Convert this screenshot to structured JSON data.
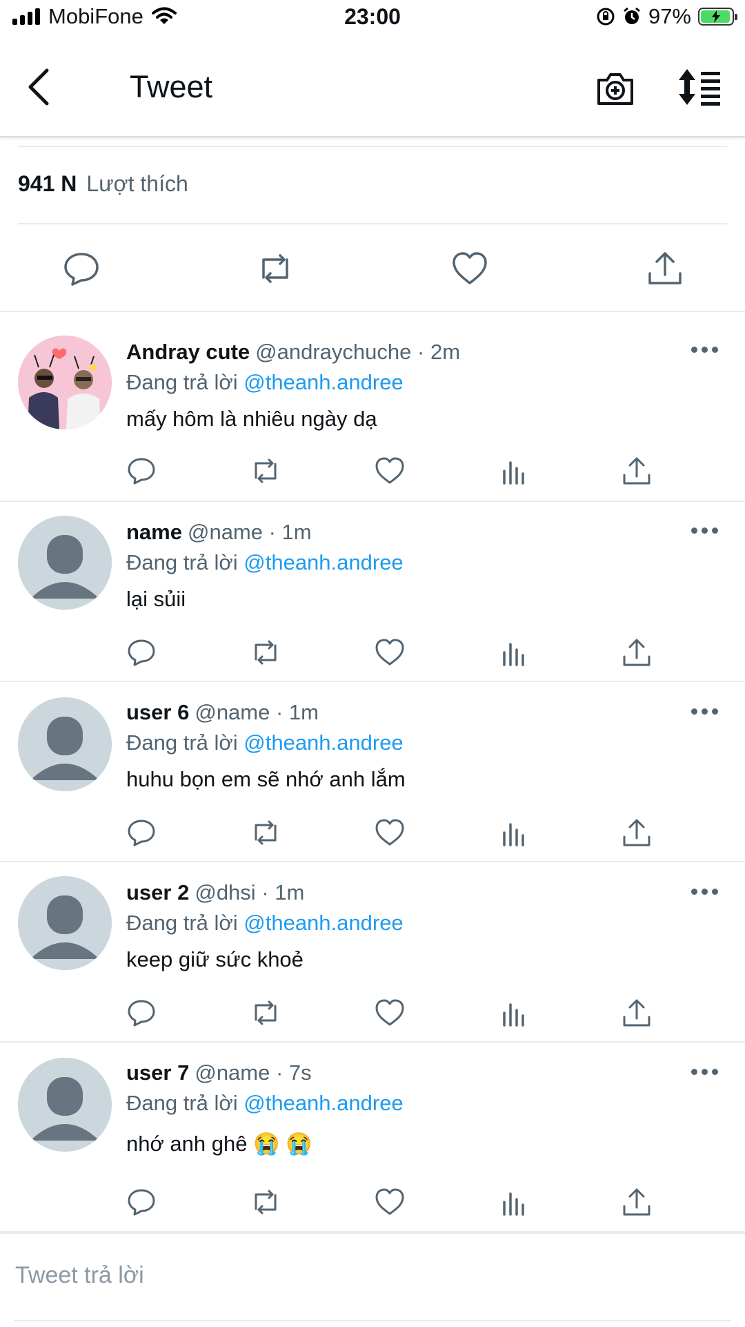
{
  "status_bar": {
    "carrier": "MobiFone",
    "time": "23:00",
    "battery": "97%"
  },
  "header": {
    "title": "Tweet"
  },
  "tweet": {
    "likes_count": "941 N",
    "likes_label": "Lượt thích"
  },
  "replying_to_label": "Đang trả lời",
  "replies": [
    {
      "name": "Andray cute",
      "handle": "@andraychuche",
      "time": "· 2m",
      "mention": "@theanh.andree",
      "text": "mấy hôm là nhiêu ngày dạ"
    },
    {
      "name": "name",
      "handle": "@name",
      "time": "· 1m",
      "mention": "@theanh.andree",
      "text": "lại sủii"
    },
    {
      "name": "user 6",
      "handle": "@name",
      "time": "· 1m",
      "mention": "@theanh.andree",
      "text": "huhu bọn em sẽ nhớ anh lắm"
    },
    {
      "name": "user 2",
      "handle": "@dhsi",
      "time": "· 1m",
      "mention": "@theanh.andree",
      "text": "keep giữ sức khoẻ"
    },
    {
      "name": "user 7",
      "handle": "@name",
      "time": "· 7s",
      "mention": "@theanh.andree",
      "text": "nhớ anh ghê 😭 😭"
    }
  ],
  "compose": {
    "placeholder": "Tweet trả lời"
  },
  "colors": {
    "accent": "#1d9bf0",
    "secondary_text": "#536471",
    "battery": "#4cd964"
  }
}
